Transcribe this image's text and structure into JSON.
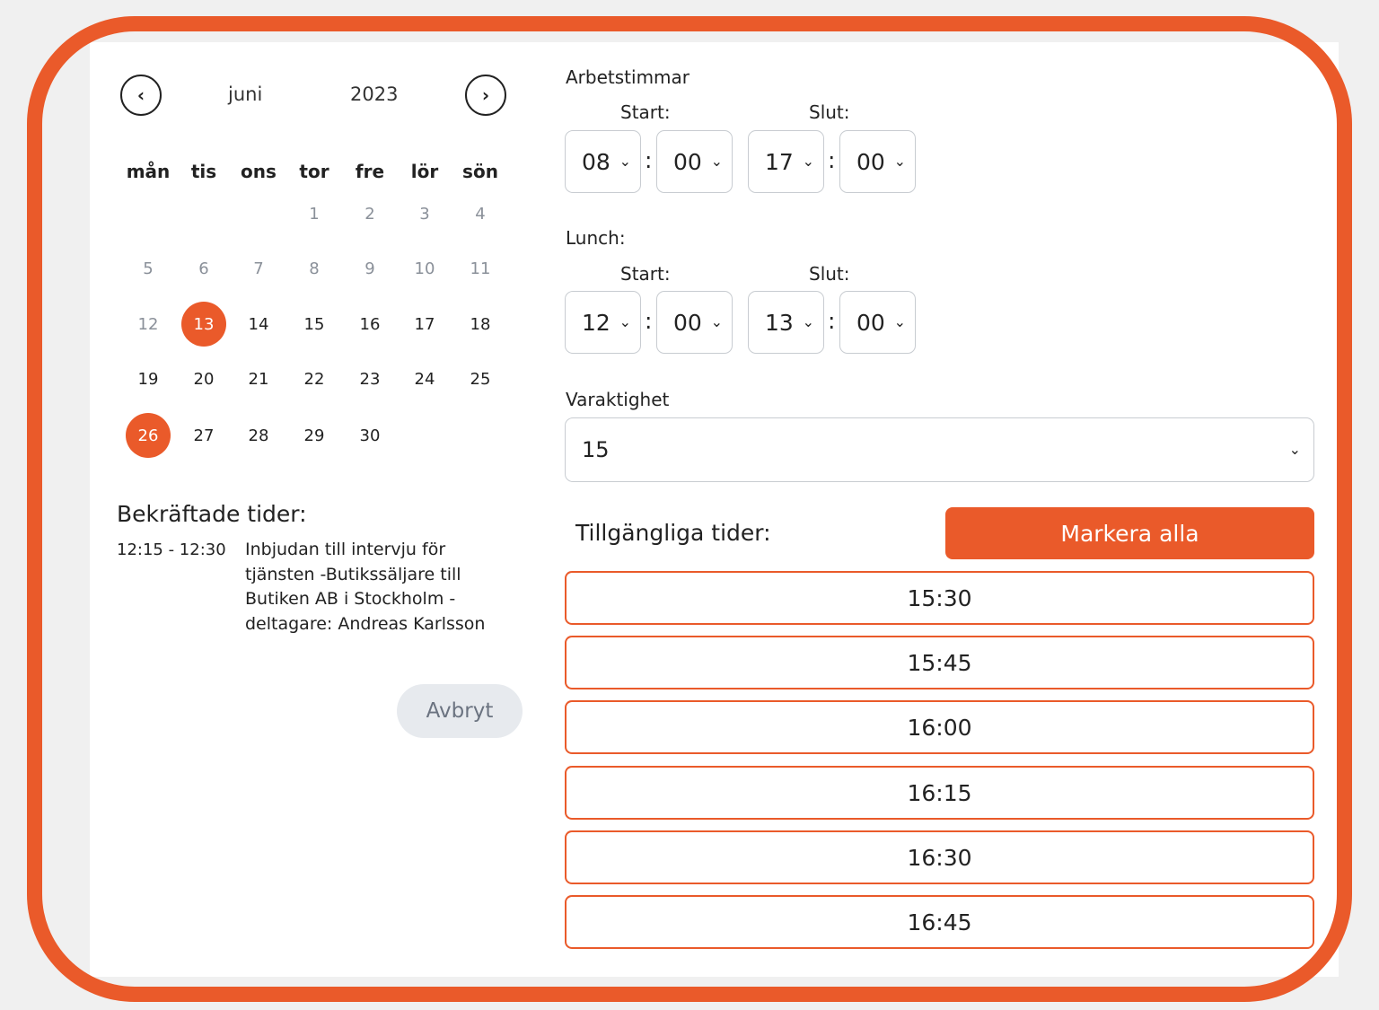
{
  "calendar": {
    "month": "juni",
    "year": "2023",
    "weekdays": [
      "mån",
      "tis",
      "ons",
      "tor",
      "fre",
      "lör",
      "sön"
    ],
    "days": [
      "1",
      "2",
      "3",
      "4",
      "5",
      "6",
      "7",
      "8",
      "9",
      "10",
      "11",
      "12",
      "13",
      "14",
      "15",
      "16",
      "17",
      "18",
      "19",
      "20",
      "21",
      "22",
      "23",
      "24",
      "25",
      "26",
      "27",
      "28",
      "29",
      "30"
    ],
    "selected_days": [
      "13",
      "26"
    ]
  },
  "confirmed": {
    "title": "Bekräftade tider:",
    "items": [
      {
        "time": "12:15 - 12:30",
        "description": "Inbjudan till intervju för tjänsten -Butikssäljare till Butiken AB i Stockholm - deltagare: Andreas Karlsson"
      }
    ]
  },
  "cancel_label": "Avbryt",
  "work_hours": {
    "title": "Arbetstimmar",
    "start_label": "Start:",
    "end_label": "Slut:",
    "start_hour": "08",
    "start_minute": "00",
    "end_hour": "17",
    "end_minute": "00"
  },
  "lunch": {
    "title": "Lunch:",
    "start_label": "Start:",
    "end_label": "Slut:",
    "start_hour": "12",
    "start_minute": "00",
    "end_hour": "13",
    "end_minute": "00"
  },
  "duration": {
    "title": "Varaktighet",
    "value": "15"
  },
  "available": {
    "title": "Tillgängliga tider:",
    "mark_all_label": "Markera alla",
    "slots": [
      "15:30",
      "15:45",
      "16:00",
      "16:15",
      "16:30",
      "16:45"
    ]
  },
  "colors": {
    "accent": "#ea5a2a",
    "muted_text": "#8a9099"
  }
}
